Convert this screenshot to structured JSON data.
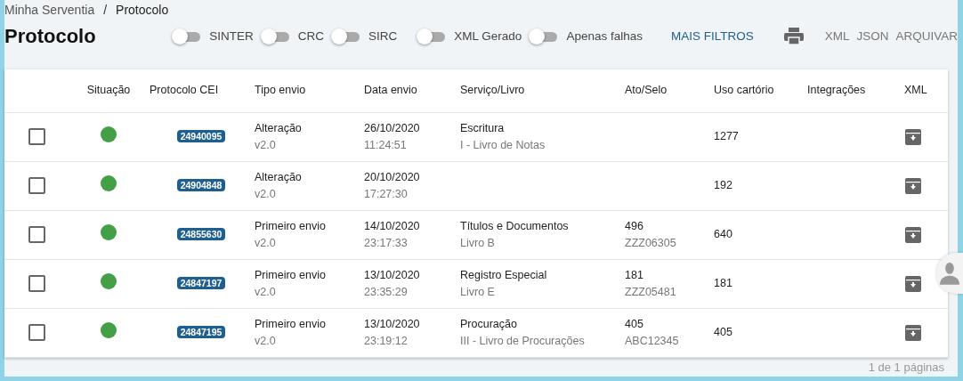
{
  "breadcrumb": [
    {
      "label": "Minha Serventia",
      "kind": "link"
    },
    {
      "label": "/",
      "kind": "sep"
    },
    {
      "label": "Protocolo",
      "kind": "current"
    }
  ],
  "title": "Protocolo",
  "filters": [
    {
      "label": "SINTER",
      "on": false
    },
    {
      "label": "CRC",
      "on": false
    },
    {
      "label": "SIRC",
      "on": false
    },
    {
      "label": "XML Gerado",
      "on": false
    },
    {
      "label": "Apenas falhas",
      "on": false
    }
  ],
  "more_filters": "MAIS FILTROS",
  "actions": [
    "XML",
    "JSON",
    "ARQUIVAR"
  ],
  "table": {
    "columns": [
      "Situação",
      "Protocolo CEI",
      "Tipo envio",
      "Data envio",
      "Serviço/Livro",
      "Ato/Selo",
      "Uso cartório",
      "Integrações",
      "XML"
    ],
    "rows": [
      {
        "checked": false,
        "color": "#43a047",
        "protocol": "24940095",
        "type": "Alteração",
        "version": "v2.0",
        "date": "26/10/2020",
        "time": "11:24:51",
        "service": "Escritura",
        "book": "I - Livro de Notas",
        "uso": "1277"
      },
      {
        "checked": false,
        "color": "#43a047",
        "protocol": "24904848",
        "type": "Alteração",
        "version": "v2.0",
        "date": "20/10/2020",
        "time": "17:27:30",
        "uso": "192"
      },
      {
        "checked": false,
        "color": "#43a047",
        "protocol": "24855630",
        "type": "Primeiro envio",
        "version": "v2.0",
        "date": "14/10/2020",
        "time": "23:17:33",
        "service": "Títulos e Documentos",
        "book": "Livro B",
        "ato": "496",
        "selo": "ZZZ06305",
        "uso": "640"
      },
      {
        "checked": false,
        "color": "#43a047",
        "protocol": "24847197",
        "type": "Primeiro envio",
        "version": "v2.0",
        "date": "13/10/2020",
        "time": "23:35:29",
        "service": "Registro Especial",
        "book": "Livro E",
        "ato": "181",
        "selo": "ZZZ05481",
        "uso": "181"
      },
      {
        "checked": false,
        "color": "#43a047",
        "protocol": "24847195",
        "type": "Primeiro envio",
        "version": "v2.0",
        "date": "13/10/2020",
        "time": "23:19:12",
        "service": "Procuração",
        "book": "III - Livro de Procurações",
        "ato": "405",
        "selo": "ABC12345",
        "uso": "405"
      }
    ]
  },
  "pagination": "1 de 1 páginas"
}
